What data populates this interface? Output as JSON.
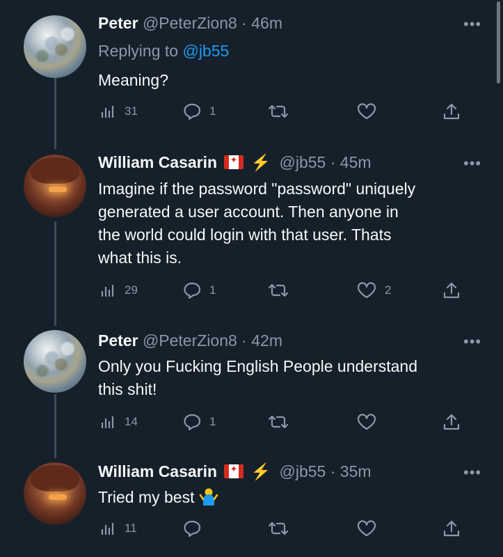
{
  "tweets": [
    {
      "name": "Peter",
      "handle": "@PeterZion8",
      "time": "46m",
      "reply_prefix": "Replying to ",
      "reply_mention": "@jb55",
      "text": "Meaning?",
      "views": "31",
      "replies": "1",
      "retweets": "",
      "likes": ""
    },
    {
      "name": "William Casarin",
      "handle": "@jb55",
      "time": "45m",
      "text_lines": [
        "Imagine if the password \"password\" uniquely",
        "generated a user account. Then anyone in",
        "the world could login with that user. Thats",
        "what this is."
      ],
      "views": "29",
      "replies": "1",
      "retweets": "",
      "likes": "2"
    },
    {
      "name": "Peter",
      "handle": "@PeterZion8",
      "time": "42m",
      "text_lines": [
        "Only you Fucking English People understand",
        "this shit!"
      ],
      "views": "14",
      "replies": "1",
      "retweets": "",
      "likes": ""
    },
    {
      "name": "William Casarin",
      "handle": "@jb55",
      "time": "35m",
      "text": "Tried my best",
      "views": "11",
      "replies": "",
      "retweets": "",
      "likes": ""
    }
  ],
  "separator": " · ",
  "more_glyph": "•••",
  "bolt_glyph": "⚡",
  "icons": [
    "views-icon",
    "reply-icon",
    "retweet-icon",
    "like-icon",
    "share-icon",
    "more-icon",
    "canada-flag-icon",
    "lightning-icon",
    "shrug-emoji-icon"
  ],
  "colors": {
    "background": "#15202b",
    "text": "#f7f9f9",
    "muted": "#8b98a5",
    "link": "#1d9bf0",
    "thread": "#3d4b59"
  }
}
